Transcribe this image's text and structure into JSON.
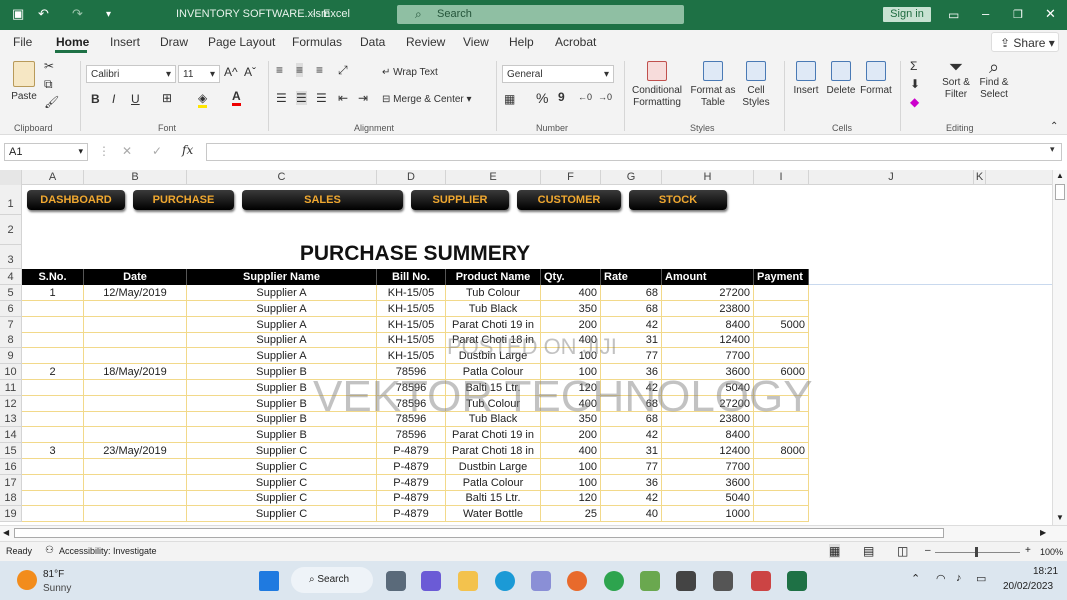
{
  "titlebar": {
    "filename": "INVENTORY SOFTWARE.xlsm",
    "sep": "-",
    "app": "Excel",
    "search_placeholder": "Search",
    "signin": "Sign in"
  },
  "menu": {
    "items": [
      "File",
      "Home",
      "Insert",
      "Draw",
      "Page Layout",
      "Formulas",
      "Data",
      "Review",
      "View",
      "Help",
      "Acrobat"
    ],
    "active": "Home",
    "share": "Share"
  },
  "ribbon": {
    "clipboard": {
      "paste": "Paste",
      "label": "Clipboard"
    },
    "font": {
      "family": "Calibri",
      "size": "11",
      "label": "Font",
      "bold": "B",
      "italic": "I",
      "underline": "U",
      "grow": "A^",
      "shrink": "Aˇ"
    },
    "alignment": {
      "wrap": "Wrap Text",
      "merge": "Merge & Center",
      "label": "Alignment"
    },
    "number": {
      "format": "General",
      "label": "Number",
      "percent": "%",
      "comma": "9"
    },
    "styles": {
      "conditional": "Conditional Formatting",
      "format_table": "Format as Table",
      "cell_styles": "Cell Styles",
      "label": "Styles"
    },
    "cells": {
      "insert": "Insert",
      "delete": "Delete",
      "format": "Format",
      "label": "Cells"
    },
    "editing": {
      "sort": "Sort & Filter",
      "find": "Find & Select",
      "label": "Editing"
    }
  },
  "formula_bar": {
    "namebox": "A1",
    "fx": "fx",
    "cancel": "✕",
    "enter": "✓",
    "value": ""
  },
  "columns": [
    "A",
    "B",
    "C",
    "D",
    "E",
    "F",
    "G",
    "H",
    "I",
    "J",
    "K"
  ],
  "rows": [
    "1",
    "2",
    "3",
    "4",
    "5",
    "6",
    "7",
    "8",
    "9",
    "10",
    "11",
    "12",
    "13",
    "14",
    "15",
    "16",
    "17",
    "18",
    "19"
  ],
  "nav_buttons": [
    "DASHBOARD",
    "PURCHASE",
    "SALES",
    "SUPPLIER",
    "CUSTOMER",
    "STOCK"
  ],
  "sheet_title": "PURCHASE SUMMERY",
  "table": {
    "headers": [
      "S.No.",
      "Date",
      "Supplier Name",
      "Bill No.",
      "Product Name",
      "Qty.",
      "Rate",
      "Amount",
      "Payment"
    ],
    "rows": [
      [
        "1",
        "12/May/2019",
        "Supplier A",
        "KH-15/05",
        "Tub Colour",
        "400",
        "68",
        "27200",
        ""
      ],
      [
        "",
        "",
        "Supplier A",
        "KH-15/05",
        "Tub Black",
        "350",
        "68",
        "23800",
        ""
      ],
      [
        "",
        "",
        "Supplier A",
        "KH-15/05",
        "Parat Choti 19 in",
        "200",
        "42",
        "8400",
        "5000"
      ],
      [
        "",
        "",
        "Supplier A",
        "KH-15/05",
        "Parat Choti 18 in",
        "400",
        "31",
        "12400",
        ""
      ],
      [
        "",
        "",
        "Supplier A",
        "KH-15/05",
        "Dustbin Large",
        "100",
        "77",
        "7700",
        ""
      ],
      [
        "2",
        "18/May/2019",
        "Supplier B",
        "78596",
        "Patla Colour",
        "100",
        "36",
        "3600",
        "6000"
      ],
      [
        "",
        "",
        "Supplier B",
        "78596",
        "Balti 15 Ltr.",
        "120",
        "42",
        "5040",
        ""
      ],
      [
        "",
        "",
        "Supplier B",
        "78596",
        "Tub Colour",
        "400",
        "68",
        "27200",
        ""
      ],
      [
        "",
        "",
        "Supplier B",
        "78596",
        "Tub Black",
        "350",
        "68",
        "23800",
        ""
      ],
      [
        "",
        "",
        "Supplier B",
        "78596",
        "Parat Choti 19 in",
        "200",
        "42",
        "8400",
        ""
      ],
      [
        "3",
        "23/May/2019",
        "Supplier C",
        "P-4879",
        "Parat Choti 18 in",
        "400",
        "31",
        "12400",
        "8000"
      ],
      [
        "",
        "",
        "Supplier C",
        "P-4879",
        "Dustbin Large",
        "100",
        "77",
        "7700",
        ""
      ],
      [
        "",
        "",
        "Supplier C",
        "P-4879",
        "Patla Colour",
        "100",
        "36",
        "3600",
        ""
      ],
      [
        "",
        "",
        "Supplier C",
        "P-4879",
        "Balti 15 Ltr.",
        "120",
        "42",
        "5040",
        ""
      ],
      [
        "",
        "",
        "Supplier C",
        "P-4879",
        "Water Bottle",
        "25",
        "40",
        "1000",
        ""
      ]
    ]
  },
  "watermark": {
    "line1": "POSTED ON JIJI",
    "line2": "VEKTOR TECHNOLOGY"
  },
  "status": {
    "ready": "Ready",
    "accessibility": "Accessibility: Investigate",
    "zoom": "100%"
  },
  "taskbar": {
    "temp": "81°F",
    "weather": "Sunny",
    "search": "Search",
    "time": "18:21",
    "date": "20/02/2023"
  },
  "colors": {
    "excel_green": "#1e7145",
    "header_black": "#000000",
    "nav_text": "#f0a830",
    "grid_yellow": "#f2d98a"
  }
}
